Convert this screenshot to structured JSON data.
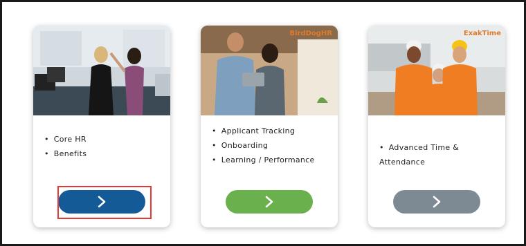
{
  "cards": [
    {
      "features": [
        "Core HR",
        "Benefits"
      ],
      "button_color": "#145a96",
      "photo_icon": "office-people-photo"
    },
    {
      "logo": "BirdDogHR",
      "logo_color": "#e07a2c",
      "features": [
        "Applicant Tracking",
        "Onboarding",
        "Learning / Performance"
      ],
      "button_color": "#6ab04c",
      "photo_icon": "business-people-tablet-photo"
    },
    {
      "logo": "ExakTime",
      "logo_color": "#e07a2c",
      "features": [
        "Advanced Time & Attendance"
      ],
      "button_color": "#7d8a93",
      "photo_icon": "construction-workers-photo"
    }
  ],
  "bullet": "•",
  "highlight_color": "#e53935"
}
